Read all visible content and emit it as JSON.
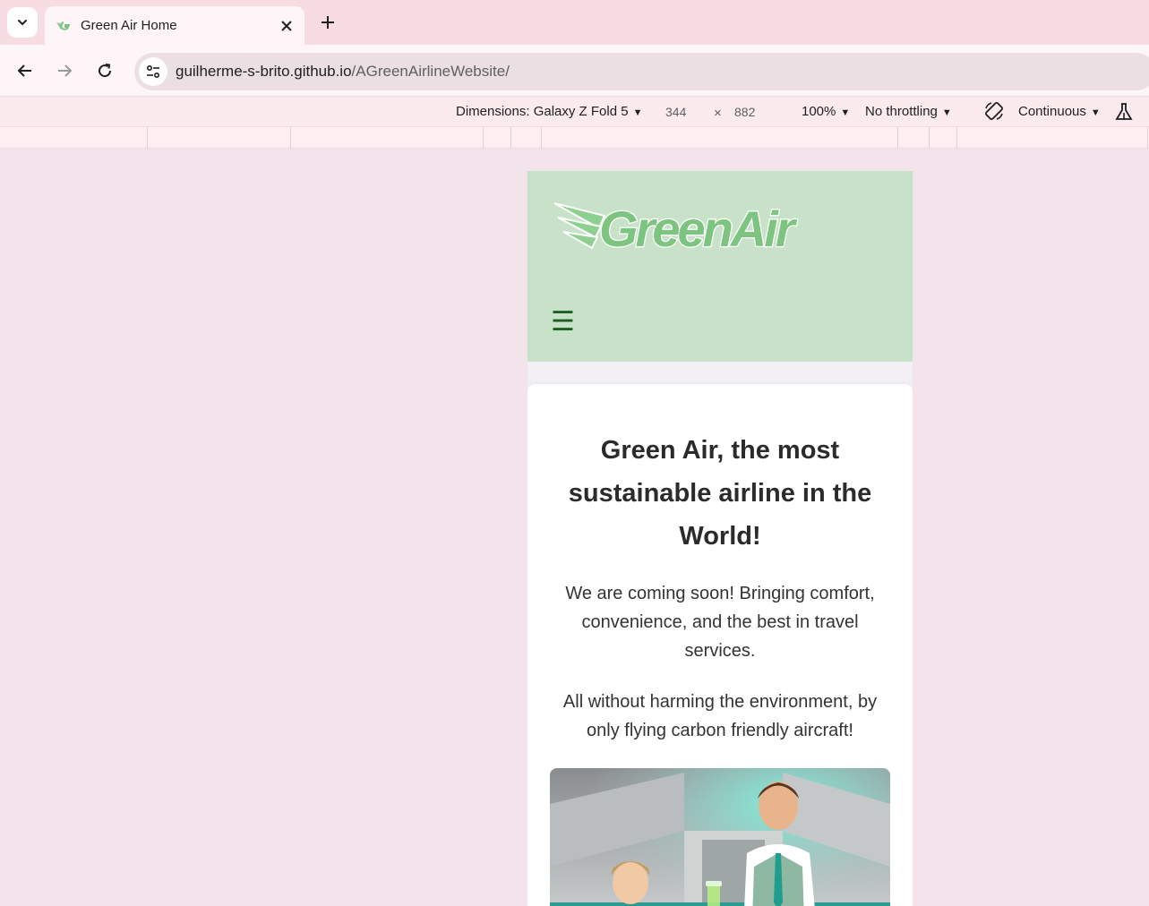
{
  "browser": {
    "tab": {
      "title": "Green Air Home",
      "favicon": "green-wing-icon"
    },
    "url": {
      "domain": "guilherme-s-brito.github.io",
      "path": "/AGreenAirlineWebsite/"
    }
  },
  "device_toolbar": {
    "dimensions_label": "Dimensions: Galaxy Z Fold 5",
    "width": "344",
    "times": "×",
    "height": "882",
    "zoom": "100%",
    "throttling": "No throttling",
    "rotate_icon": "rotate-icon",
    "mode": "Continuous",
    "experiments_icon": "flask-icon"
  },
  "site": {
    "logo_text": "GreenAir",
    "menu_icon": "☰",
    "hero_title": "Green Air, the most sustainable airline in the World!",
    "paragraph_1": "We are coming soon! Bringing comfort, convenience, and the best in travel services.",
    "paragraph_2": "All without harming the environment, by only flying carbon friendly aircraft!"
  },
  "colors": {
    "header_green": "#c8e2c9",
    "logo_green": "#7cc47f",
    "menu_green": "#1b5e20",
    "uniform_teal": "#2fb4a3"
  }
}
